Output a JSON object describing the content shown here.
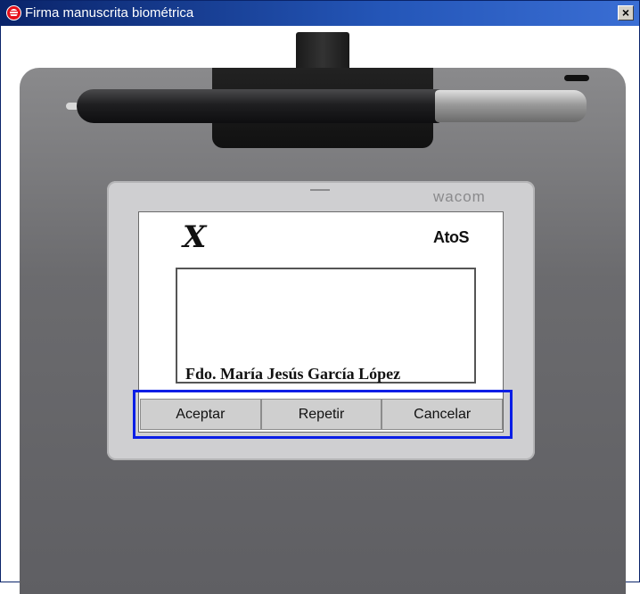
{
  "window": {
    "title": "Firma manuscrita biométrica",
    "close_label": "×"
  },
  "device": {
    "brand": "wacom"
  },
  "screen": {
    "logo_left_text": "X",
    "logo_right_text": "AtoS",
    "signer_label": "Fdo. María Jesús García López"
  },
  "actions": [
    {
      "label": "Aceptar"
    },
    {
      "label": "Repetir"
    },
    {
      "label": "Cancelar"
    }
  ],
  "colors": {
    "highlight": "#0a1ee6",
    "titlebar": "#0a246a"
  }
}
